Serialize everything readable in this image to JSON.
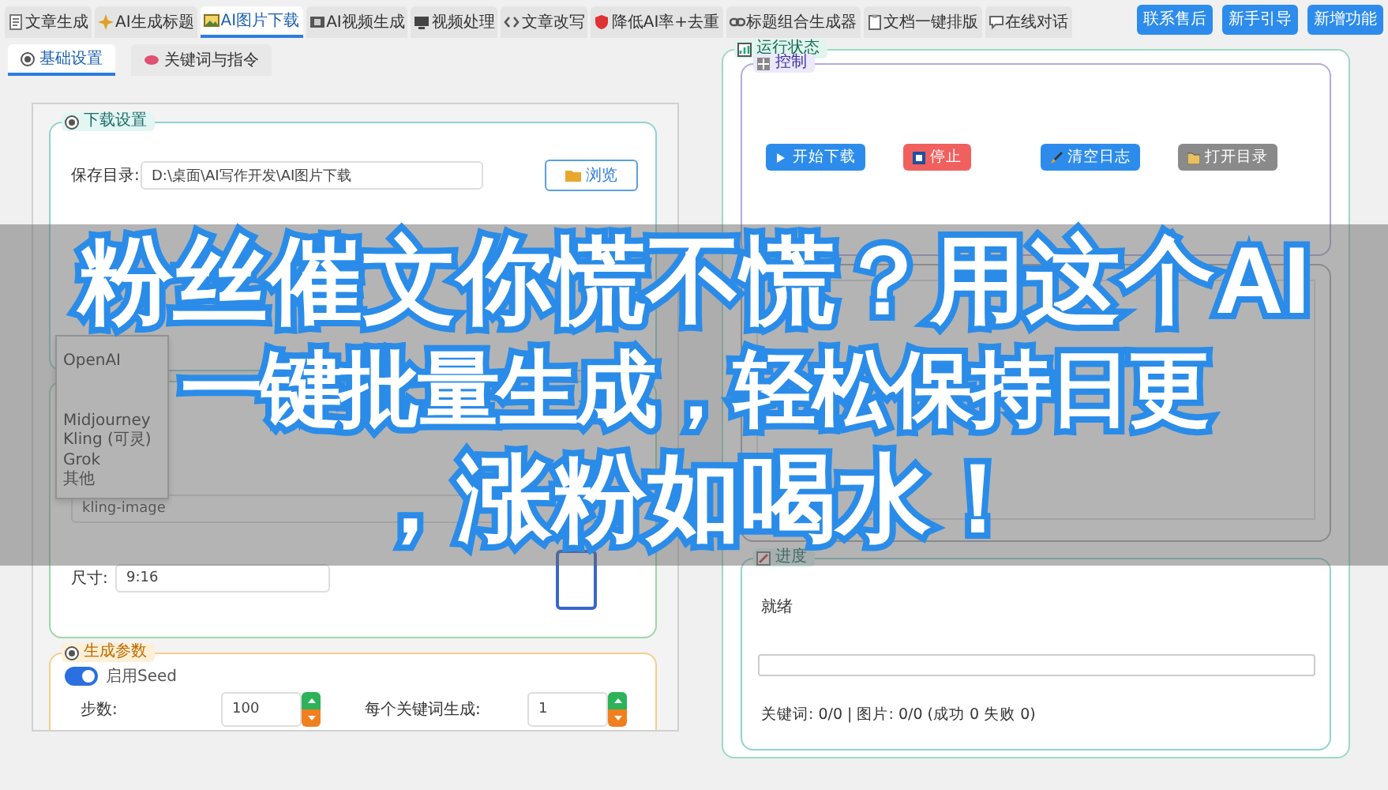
{
  "top_tabs": [
    {
      "label": "文章生成",
      "selected": false
    },
    {
      "label": "AI生成标题",
      "selected": false
    },
    {
      "label": "AI图片下载",
      "selected": true
    },
    {
      "label": "AI视频生成",
      "selected": false
    },
    {
      "label": "视频处理",
      "selected": false
    },
    {
      "label": "文章改写",
      "selected": false
    },
    {
      "label": "降低AI率+去重",
      "selected": false
    },
    {
      "label": "标题组合生成器",
      "selected": false
    },
    {
      "label": "文档一键排版",
      "selected": false
    },
    {
      "label": "在线对话",
      "selected": false
    }
  ],
  "top_buttons": [
    "联系售后",
    "新手引导",
    "新增功能"
  ],
  "sub_tabs": [
    {
      "label": "基础设置",
      "selected": true
    },
    {
      "label": "关键词与指令",
      "selected": false
    }
  ],
  "download_settings": {
    "title": "下载设置",
    "save_dir_label": "保存目录:",
    "save_dir": "D:\\桌面\\AI写作开发\\AI图片下载",
    "browse_button": "浏览"
  },
  "model_group": {
    "dropdown_options": [
      "OpenAI",
      "Midjourney",
      "Kling (可灵)",
      "Grok",
      "其他"
    ],
    "model": "kling-image",
    "size_label": "尺寸:",
    "size": "9:16"
  },
  "gen_params": {
    "title": "生成参数",
    "seed_label": "启用Seed",
    "seed_on": true,
    "steps_label": "步数:",
    "steps": "100",
    "per_keyword_label": "每个关键词生成:",
    "per_keyword": "1"
  },
  "status_panel": {
    "title": "运行状态",
    "control_title": "控制",
    "buttons": [
      {
        "label": "开始下载",
        "kind": "start"
      },
      {
        "label": "停止",
        "kind": "stop"
      },
      {
        "label": "清空日志",
        "kind": "clear"
      },
      {
        "label": "打开目录",
        "kind": "open"
      }
    ],
    "progress_title": "进度",
    "status": "就绪",
    "level": 0,
    "stats": "关键词: 0/0 | 图片: 0/0 (成功 0 失败 0)"
  },
  "caption": [
    "粉丝催文你慌不慌？用这个AI",
    "一键批量生成，轻松保持日更",
    "，涨粉如喝水！"
  ]
}
